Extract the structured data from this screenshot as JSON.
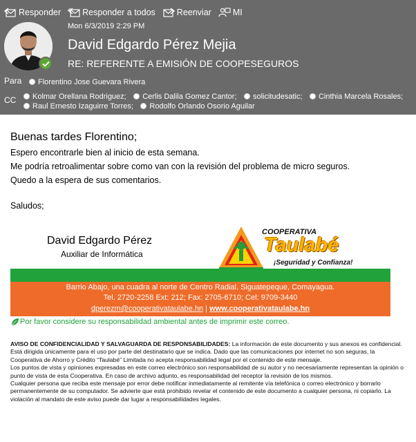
{
  "toolbar": {
    "reply": "Responder",
    "reply_all": "Responder a todos",
    "forward": "Reenviar",
    "more": "MI"
  },
  "message": {
    "date": "Mon 6/3/2019 2:29 PM",
    "sender": "David Edgardo Pérez Mejia",
    "subject": "RE: REFERENTE A EMISIÓN DE COOPESEGUROS",
    "to_label": "Para",
    "cc_label": "CC",
    "to": [
      "Florentino Jose Guevara Rivera"
    ],
    "cc_row1": [
      "Kolmar Orellana Rodriguez;",
      "Cerlis Dalila Gomez Cantor;",
      "solicitudesatic;",
      "Cinthia Marcela Rosales;"
    ],
    "cc_row2": [
      "Raul Ernesto Izaguirre Torres;",
      "Rodolfo Orlando Osorio Aguilar"
    ]
  },
  "body": {
    "greeting": "Buenas tardes Florentino;",
    "line1": "Espero encontrarle bien al inicio de esta semana.",
    "line2": "Me podría retroalimentar sobre como van con la revisión del problema de micro seguros.",
    "line3": "Quedo a la espera de sus comentarios.",
    "closing": "Saludos;"
  },
  "signature": {
    "name": "David Edgardo Pérez",
    "title": "Auxiliar de Informática",
    "logo_top": "COOPERATIVA",
    "logo_brand": "Taulabé",
    "logo_tagline": "¡Seguridad y Confianza!",
    "address": "Barrio Abajo, una cuadra al norte de Centro Radial, Siguatepeque, Comayagua.",
    "phones": "Tel. 2720-2258 Ext: 212; Fax: 2705-6710; Cel: 9709-3440",
    "email": "dperezm@cooperativataulabe.hn",
    "separator": "|",
    "website": "www.cooperativataulabe.hn",
    "eco_note": "Por favor considere su responsabilidad ambiental antes de imprimir este correo."
  },
  "disclaimer": {
    "heading": "AVISO DE CONFIDENCIALIDAD Y SALVAGUARDA DE RESPONSABILIDADES:",
    "p1": " La información de este documento y sus anexos es confidencial. Está dirigida únicamente para el uso por parte del destinatario que se indica. Dado que las comunicaciones por internet no son seguras, la Cooperativa de Ahorro y Crédito “Taulabé” Limitada no acepta responsabilidad legal por el contenido de este mensaje.",
    "p2": "Los puntos de vista y opiniones expresadas en este correo electrónico son responsabilidad de su autor y no necesariamente representan la opinión o punto de vista de esta Cooperativa. En caso de archivo adjunto, es responsabilidad del receptor la revisión de los mismos.",
    "p3": "Cualquier persona que reciba este mensaje por error debe notificar inmediatamente al remitente vía telefónica o correo electrónico y borrarlo permanentemente de su computador. Se advierte que está prohibido revelar el contenido de este documento a cualquier persona, ni copiarlo. La violación al mandato de este aviso puede dar lugar a responsabilidades legales."
  },
  "colors": {
    "header_bg": "#6a6a6a",
    "presence": "#5ea72e",
    "green_bar": "#22a23a",
    "orange_band": "#ee6b2a",
    "brand_yellow": "#ffb400"
  }
}
